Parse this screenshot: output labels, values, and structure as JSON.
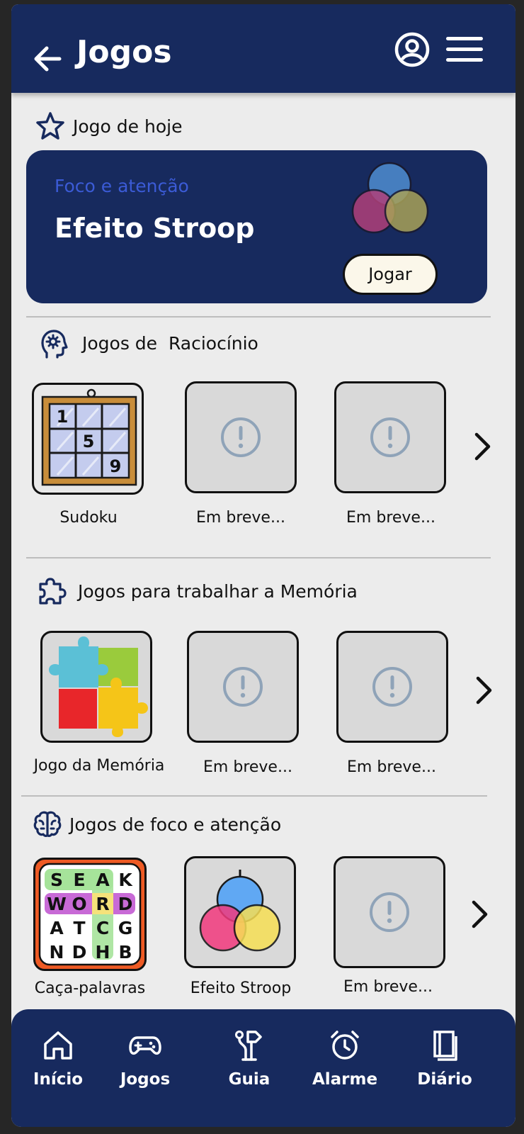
{
  "header": {
    "title": "Jogos"
  },
  "today": {
    "section_label": "Jogo de hoje",
    "category": "Foco e atenção",
    "game_name": "Efeito Stroop",
    "play_label": "Jogar"
  },
  "sections": {
    "reasoning": {
      "title": "Jogos de  Raciocínio",
      "games": [
        "Sudoku",
        "Em breve...",
        "Em breve..."
      ]
    },
    "memory": {
      "title": "Jogos para trabalhar a Memória",
      "games": [
        "Jogo da Memória",
        "Em breve...",
        "Em breve..."
      ]
    },
    "focus": {
      "title": "Jogos de foco e atenção",
      "games": [
        "Caça-palavras",
        "Efeito Stroop",
        "Em breve..."
      ]
    }
  },
  "sudoku_digits": [
    "1",
    "5",
    "9"
  ],
  "wordsearch_rows": [
    [
      "S",
      "E",
      "A",
      "K"
    ],
    [
      "W",
      "O",
      "R",
      "D"
    ],
    [
      "A",
      "T",
      "C",
      "G"
    ],
    [
      "N",
      "D",
      "H",
      "B"
    ]
  ],
  "nav": [
    {
      "label": "Início",
      "icon": "home-icon"
    },
    {
      "label": "Jogos",
      "icon": "gamepad-icon"
    },
    {
      "label": "Guia",
      "icon": "signpost-icon"
    },
    {
      "label": "Alarme",
      "icon": "alarm-clock-icon"
    },
    {
      "label": "Diário",
      "icon": "book-icon"
    }
  ],
  "colors": {
    "primary": "#172a5e",
    "background": "#ececec",
    "accent_text": "#3b5bd6",
    "tile_bg": "#d9d9d9",
    "placeholder_icon": "#8fa3b8"
  }
}
